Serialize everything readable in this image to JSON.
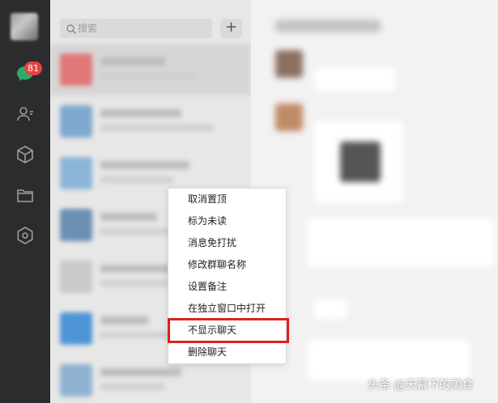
{
  "sidebar": {
    "chat_badge": "81",
    "icons": [
      "chat-icon",
      "contacts-icon",
      "cube-icon",
      "folder-icon",
      "mini-program-icon"
    ]
  },
  "search": {
    "placeholder": "搜索",
    "add_label": "+"
  },
  "context_menu": {
    "items": [
      "取消置顶",
      "标为未读",
      "消息免打扰",
      "修改群聊名称",
      "设置备注",
      "在独立窗口中打开",
      "不显示聊天",
      "删除聊天"
    ],
    "highlighted_index": 6
  },
  "colors": {
    "highlight_border": "#e02020",
    "badge": "#e64340",
    "rail": "#2b2c2e"
  },
  "watermark": "头条 @天幕下的美食"
}
